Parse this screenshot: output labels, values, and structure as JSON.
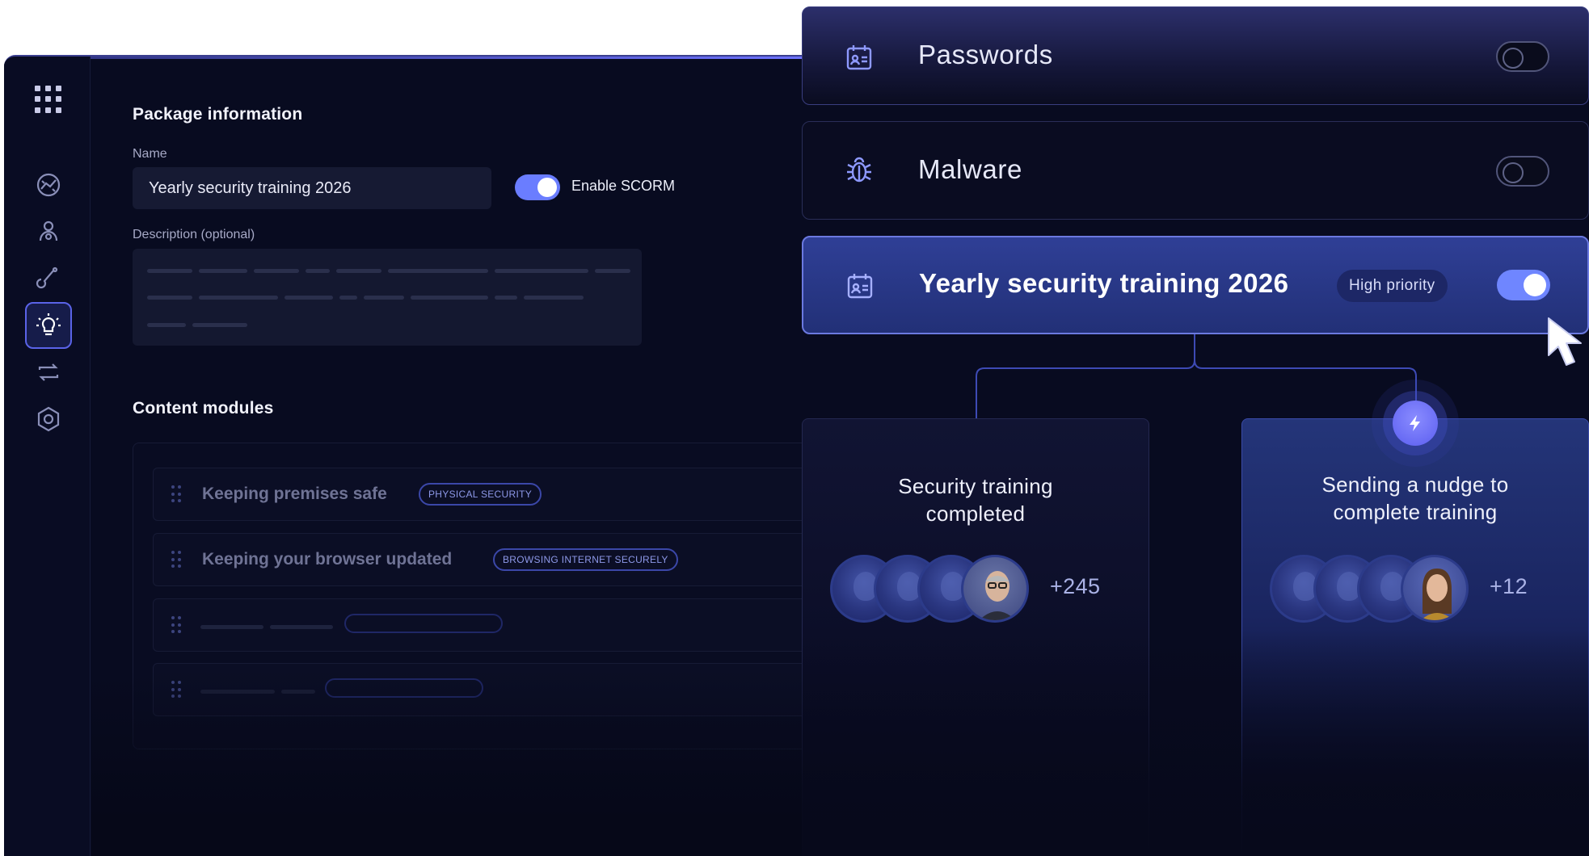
{
  "package": {
    "section_title": "Package information",
    "name_label": "Name",
    "name_value": "Yearly security training 2026",
    "scorm_label": "Enable SCORM",
    "scorm_enabled": true,
    "description_label": "Description (optional)"
  },
  "modules": {
    "section_title": "Content modules",
    "items": [
      {
        "title": "Keeping premises safe",
        "tag": "PHYSICAL SECURITY"
      },
      {
        "title": "Keeping your browser updated",
        "tag": "BROWSING INTERNET SECURELY"
      }
    ]
  },
  "sidebar": {
    "icons": [
      "apps-grid-icon",
      "dashboard-icon",
      "users-icon",
      "phishing-hook-icon",
      "training-bulb-icon",
      "sync-icon",
      "settings-hex-icon"
    ],
    "active": "training-bulb-icon"
  },
  "topics": [
    {
      "title": "Passwords",
      "icon": "id-card-calendar-icon",
      "enabled": false
    },
    {
      "title": "Malware",
      "icon": "bug-icon",
      "enabled": false
    },
    {
      "title": "Yearly security training 2026",
      "icon": "id-card-calendar-icon",
      "badge": "High priority",
      "enabled": true
    }
  ],
  "results": {
    "completed": {
      "title_line1": "Security training",
      "title_line2": "completed",
      "extra_count": "+245"
    },
    "nudge": {
      "title_line1": "Sending a nudge to",
      "title_line2": "complete training",
      "extra_count": "+12"
    }
  },
  "colors": {
    "accent": "#6f86ff",
    "background": "#080b20",
    "card_active": "#2a3a8c"
  }
}
